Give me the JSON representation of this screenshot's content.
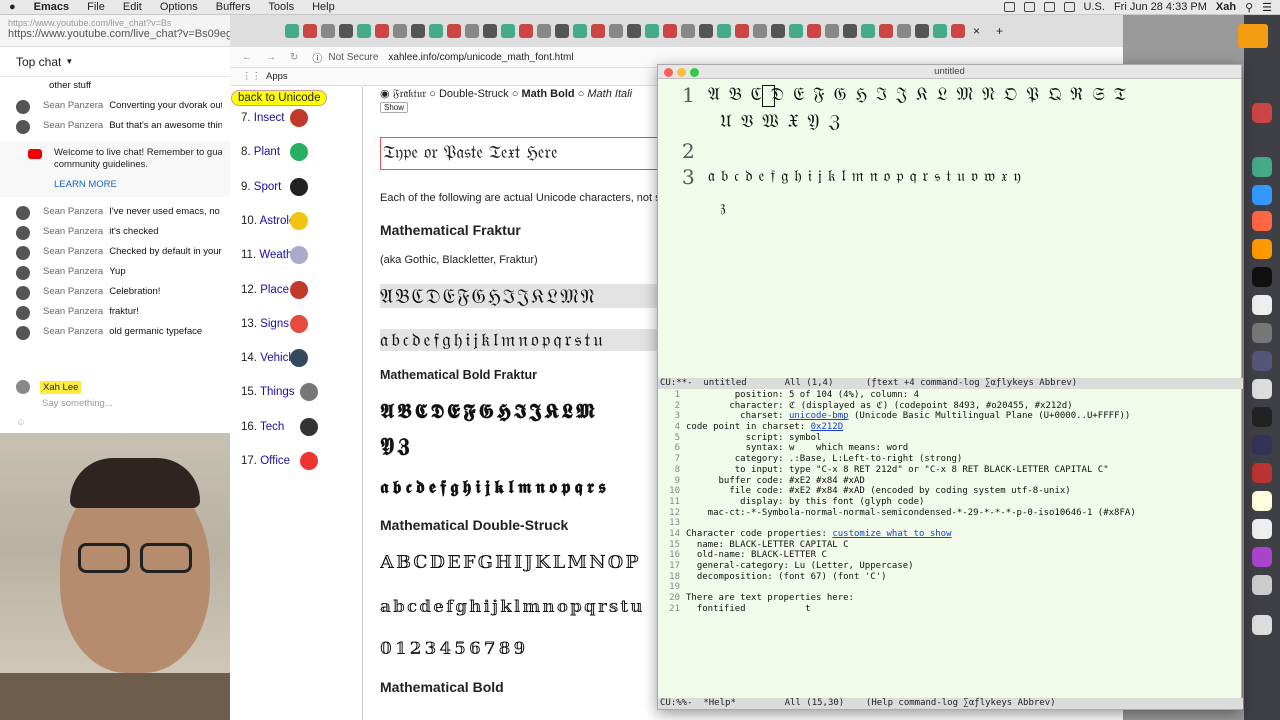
{
  "menubar": {
    "apple": "",
    "app": "Emacs",
    "items": [
      "File",
      "Edit",
      "Options",
      "Buffers",
      "Tools",
      "Help"
    ],
    "locale": "U.S.",
    "clock": "Fri Jun 28  4:33 PM",
    "user": "Xah"
  },
  "chat": {
    "url_top": "https://www.youtube.com/live_chat?v=Bs",
    "url": "https://www.youtube.com/live_chat?v=Bs09eg",
    "header": "Top chat",
    "messages": [
      {
        "name": "",
        "text": "other stuff"
      },
      {
        "name": "Sean Panzera",
        "text": "Converting your dvorak output"
      },
      {
        "name": "Sean Panzera",
        "text": "But that's an awesome thing to"
      }
    ],
    "notice": {
      "line1": "Welcome to live chat! Remember to guard your",
      "line2": "community guidelines.",
      "learn": "LEARN MORE"
    },
    "messages2": [
      {
        "name": "Sean Panzera",
        "text": "I've never used emacs, no"
      },
      {
        "name": "Sean Panzera",
        "text": "it's checked"
      },
      {
        "name": "Sean Panzera",
        "text": "Checked by default in your scri"
      },
      {
        "name": "Sean Panzera",
        "text": "Yup"
      },
      {
        "name": "Sean Panzera",
        "text": "Celebration!"
      },
      {
        "name": "Sean Panzera",
        "text": "fraktur!"
      },
      {
        "name": "Sean Panzera",
        "text": "old germanic typeface"
      }
    ],
    "me": "Xah Lee",
    "placeholder": "Say something..."
  },
  "browser": {
    "not_secure": "Not Secure",
    "url": "xahlee.info/comp/unicode_math_font.html",
    "apps": "Apps",
    "back": "back to Unicode",
    "side": [
      {
        "num": "7.",
        "label": "Insect"
      },
      {
        "num": "8.",
        "label": "Plant"
      },
      {
        "num": "9.",
        "label": "Sport"
      },
      {
        "num": "10.",
        "label": "Astrology"
      },
      {
        "num": "11.",
        "label": "Weather"
      },
      {
        "num": "12.",
        "label": "Place"
      },
      {
        "num": "13.",
        "label": "Signs"
      },
      {
        "num": "14.",
        "label": "Vehicle"
      },
      {
        "num": "15.",
        "label": "Things"
      },
      {
        "num": "16.",
        "label": "Tech"
      },
      {
        "num": "17.",
        "label": "Office"
      }
    ],
    "radios": [
      "𝔉𝔯𝔞𝔨𝔱𝔲𝔯",
      "Double-Struck",
      "Math Bold",
      "Math Itali"
    ],
    "show": "Show",
    "placeholder": "𝔗𝔶𝔭𝔢 𝔬𝔯 𝔓𝔞𝔰𝔱𝔢 𝔗𝔢𝔵𝔱 ℌ𝔢𝔯𝔢",
    "intro": "Each of the following are actual Unicode characters, not sty",
    "h_fraktur": "Mathematical Fraktur",
    "aka": "(aka Gothic, Blackletter, Fraktur)",
    "frak_upper": "𝔄𝔅ℭ𝔇𝔈𝔉𝔊ℌℑ𝔍𝔎𝔏𝔐𝔑",
    "frak_lower": "𝔞𝔟𝔠𝔡𝔢𝔣𝔤𝔥𝔦𝔧𝔨𝔩𝔪𝔫𝔬𝔭𝔮𝔯𝔰𝔱𝔲",
    "h_boldfrak": "Mathematical Bold Fraktur",
    "bfrak_upper": "𝕬𝕭𝕮𝕯𝕰𝕱𝕲𝕳𝕴𝕵𝕶𝕷𝕸",
    "bfrak_upper2": "𝖄𝖅",
    "bfrak_lower": "𝖆𝖇𝖈𝖉𝖊𝖋𝖌𝖍𝖎𝖏𝖐𝖑𝖒𝖓𝖔𝖕𝖖𝖗𝖘",
    "h_ds": "Mathematical Double-Struck",
    "ds_upper": "𝔸𝔹ℂ𝔻𝔼𝔽𝔾ℍ𝕀𝕁𝕂𝕃𝕄ℕ𝕆ℙ",
    "ds_lower": "𝕒𝕓𝕔𝕕𝕖𝕗𝕘𝕙𝕚𝕛𝕜𝕝𝕞𝕟𝕠𝕡𝕢𝕣𝕤𝕥𝕦",
    "ds_digits": "𝟘𝟙𝟚𝟛𝟜𝟝𝟞𝟟𝟠𝟡",
    "h_bold": "Mathematical Bold"
  },
  "emacs": {
    "title": "untitled",
    "line1a": "𝔄𝔅ℭ𝔇𝔈𝔉𝔊ℌℑ𝔍𝔎𝔏𝔐𝔑𝔒𝔓𝔔ℜ𝔖𝔗",
    "line1b": "𝔘𝔙𝔚𝔛𝔜ℨ",
    "line3a": "𝔞𝔟𝔠𝔡𝔢𝔣𝔤𝔥𝔦𝔧𝔨𝔩𝔪𝔫𝔬𝔭𝔮𝔯𝔰𝔱𝔲𝔳𝔴𝔵𝔶",
    "line3b": "𝔷",
    "ln1": "1",
    "ln2": "2",
    "ln3": "3",
    "modeline1": "CU:**-  untitled       All (1,4)      (ƒtext +4 command-log ∑αƒlykeys Abbrev)",
    "help": [
      {
        "n": "1",
        "t": "         position: 5 of 104 (4%), column: 4"
      },
      {
        "n": "2",
        "t": "        character: ℭ (displayed as ℭ) (codepoint 8493, #o20455, #x212d)"
      },
      {
        "n": "3",
        "t": "          charset: ",
        "link": "unicode-bmp",
        "t2": " (Unicode Basic Multilingual Plane (U+0000..U+FFFF))"
      },
      {
        "n": "4",
        "t": "code point in charset: ",
        "link": "0x212D",
        "t2": ""
      },
      {
        "n": "5",
        "t": "           script: symbol"
      },
      {
        "n": "6",
        "t": "           syntax: w    which means: word"
      },
      {
        "n": "7",
        "t": "         category: .:Base, L:Left-to-right (strong)"
      },
      {
        "n": "8",
        "t": "         to input: type \"C-x 8 RET 212d\" or \"C-x 8 RET BLACK-LETTER CAPITAL C\""
      },
      {
        "n": "9",
        "t": "      buffer code: #xE2 #x84 #xAD"
      },
      {
        "n": "10",
        "t": "        file code: #xE2 #x84 #xAD (encoded by coding system utf-8-unix)"
      },
      {
        "n": "11",
        "t": "          display: by this font (glyph code)"
      },
      {
        "n": "12",
        "t": "    mac-ct:-*-Symbola-normal-normal-semicondensed-*-29-*-*-*-p-0-iso10646-1 (#x8FA)"
      },
      {
        "n": "13",
        "t": ""
      },
      {
        "n": "14",
        "t": "Character code properties: ",
        "link": "customize what to show",
        "t2": ""
      },
      {
        "n": "15",
        "t": "  name: BLACK-LETTER CAPITAL C"
      },
      {
        "n": "16",
        "t": "  old-name: BLACK-LETTER C"
      },
      {
        "n": "17",
        "t": "  general-category: Lu (Letter, Uppercase)"
      },
      {
        "n": "18",
        "t": "  decomposition: (font 67) (font 'C')"
      },
      {
        "n": "19",
        "t": ""
      },
      {
        "n": "20",
        "t": "There are text properties here:"
      },
      {
        "n": "21",
        "t": "  fontified           t"
      }
    ],
    "modeline2": "CU:%%-  *Help*         All (15,30)    (Help command-log ∑αƒlykeys Abbrev)"
  }
}
